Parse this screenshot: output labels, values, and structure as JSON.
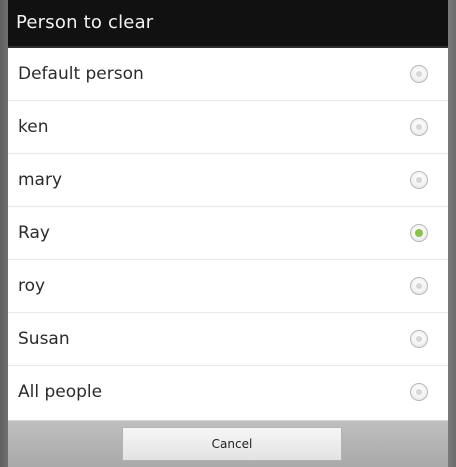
{
  "dialog": {
    "title": "Person to clear",
    "options": [
      {
        "label": "Default person",
        "selected": false
      },
      {
        "label": "ken",
        "selected": false
      },
      {
        "label": "mary",
        "selected": false
      },
      {
        "label": "Ray",
        "selected": true
      },
      {
        "label": "roy",
        "selected": false
      },
      {
        "label": "Susan",
        "selected": false
      },
      {
        "label": "All people",
        "selected": false
      }
    ],
    "cancel_label": "Cancel"
  },
  "colors": {
    "title_bar": "#111111",
    "selected_radio": "#8bc34a",
    "frame": "#6a6a6a"
  }
}
